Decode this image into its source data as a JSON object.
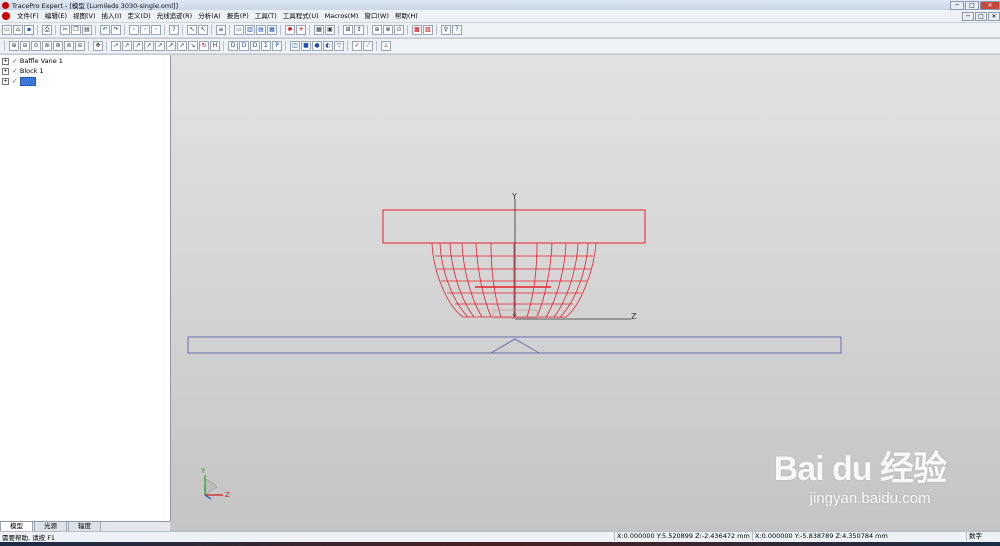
{
  "window": {
    "title": "TracePro Expert - [模型 [Lumileds 3030-single.oml]]",
    "controls": [
      "─",
      "□",
      "✕"
    ]
  },
  "menubar": {
    "items": [
      "文件(F)",
      "编辑(E)",
      "视图(V)",
      "插入(I)",
      "定义(D)",
      "光线追迹(R)",
      "分析(A)",
      "报告(P)",
      "工具(T)",
      "工具程式(U)",
      "Macros(M)",
      "窗口(W)",
      "帮助(H)"
    ],
    "controls": [
      "─",
      "□",
      "✕"
    ]
  },
  "toolbar1": {
    "buttons": [
      "new-icon",
      "open-icon",
      "save-icon",
      "print-icon",
      "cut-icon",
      "copy-icon",
      "paste-icon",
      "undo-icon",
      "redo-icon",
      "select-icon",
      "select-surface-icon",
      "edit-icon",
      "help-icon",
      "window-icon",
      "tile-icon",
      "cascade-icon",
      "grid-icon",
      "trace-icon",
      "raytrace-icon",
      "irradiance-icon",
      "candela-icon",
      "ray-sort-icon",
      "lightbulb-icon",
      "context-help-icon"
    ]
  },
  "toolbar2": {
    "buttons": [
      "zoom-in-icon",
      "zoom-out-icon",
      "zoom-window-icon",
      "zoom-all-icon",
      "zoom-select-icon",
      "zoom-dynamic-icon",
      "pan-icon",
      "view-xy-icon",
      "view-yz-icon",
      "view-xz-icon",
      "view-iso-icon",
      "view-normal-icon",
      "rotate-icon",
      "render-icon",
      "silhouette-icon",
      "surface-icon",
      "source-icon",
      "exit-surface-icon",
      "material-icon",
      "property-icon",
      "prism-icon",
      "sphere-icon",
      "cube-icon",
      "lens-icon",
      "reflector-icon",
      "check-icon",
      "measure-icon",
      "ray-icon"
    ]
  },
  "tree": {
    "items": [
      {
        "label": "Baffle Vane 1"
      },
      {
        "label": "Block 1"
      },
      {
        "label": ""
      }
    ]
  },
  "panel_tabs": [
    "模型",
    "光源",
    "辐度"
  ],
  "viewport": {
    "axis_y": "Y",
    "axis_z": "Z",
    "axis_x": "X",
    "triad_y": "Y",
    "triad_z": "Z",
    "colors": {
      "model": "#e8202a",
      "plane": "#6a6ab0",
      "axis": "#333333",
      "triad_y": "#1aa31a",
      "triad_z": "#d02020",
      "triad_x": "#1a4fd0"
    }
  },
  "watermark": {
    "logo": "Bai du 经验",
    "url": "jingyan.baidu.com"
  },
  "statusbar": {
    "help": "需要帮助, 请按 F1",
    "coord1": "X:0.000000 Y:5.520899 Z:-2.436472 mm",
    "coord2": "X:0.000000 Y:-5.838789 Z:4.350784 mm",
    "mode": "数字"
  }
}
